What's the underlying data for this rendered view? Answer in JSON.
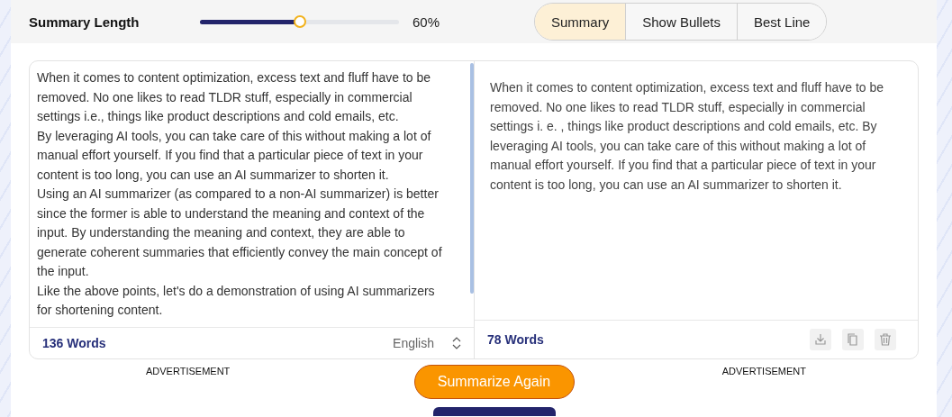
{
  "toolbar": {
    "label": "Summary Length",
    "slider": {
      "level": 0.5
    },
    "reading": "60%",
    "modes": [
      {
        "label": "Summary",
        "selected": true
      },
      {
        "label": "Show Bullets",
        "selected": false
      },
      {
        "label": "Best Line",
        "selected": false
      }
    ]
  },
  "input": {
    "paragraphs": [
      "When it comes to content optimization, excess text and fluff have to be removed. No one likes to read TLDR stuff, especially in commercial settings i.e., things like product descriptions and cold emails, etc.",
      "By leveraging AI tools, you can take care of this without making a lot of manual effort yourself. If you find that a particular piece of text in your content is too long, you can use an AI summarizer to shorten it.",
      "Using an AI summarizer (as compared to a non-AI summarizer) is better since the former is able to understand the meaning and context of the input. By understanding the meaning and context, they are able to generate coherent summaries that efficiently convey the main concept of the input.",
      "Like the above points, let's do a demonstration of using AI summarizers for shortening content."
    ],
    "word_count": "136 Words",
    "language": "English"
  },
  "output": {
    "text": "When it comes to content optimization, excess text and fluff have to be removed. No one likes to read TLDR stuff, especially in commercial settings i. e. , things like product descriptions and cold emails, etc. By leveraging AI tools, you can take care of this without making a lot of manual effort yourself. If you find that a particular piece of text in your content is too long, you can use an AI summarizer to shorten it.",
    "word_count": "78 Words"
  },
  "ads": [
    "ADVERTISEMENT",
    "ADVERTISEMENT"
  ],
  "action": "Summarize Again"
}
